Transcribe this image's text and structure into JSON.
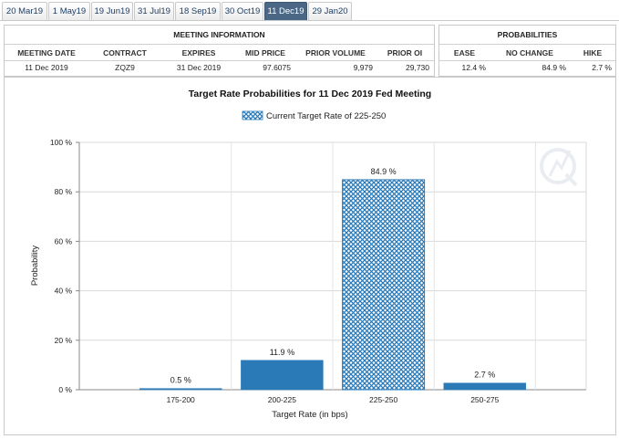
{
  "tabs": [
    {
      "label": "20 Mar19",
      "active": false
    },
    {
      "label": "1 May19",
      "active": false
    },
    {
      "label": "19 Jun19",
      "active": false
    },
    {
      "label": "31 Jul19",
      "active": false
    },
    {
      "label": "18 Sep19",
      "active": false
    },
    {
      "label": "30 Oct19",
      "active": false
    },
    {
      "label": "11 Dec19",
      "active": true
    },
    {
      "label": "29 Jan20",
      "active": false
    }
  ],
  "meeting_info": {
    "title": "MEETING INFORMATION",
    "headers": [
      "MEETING DATE",
      "CONTRACT",
      "EXPIRES",
      "MID PRICE",
      "PRIOR VOLUME",
      "PRIOR OI"
    ],
    "values": [
      "11 Dec 2019",
      "ZQZ9",
      "31 Dec 2019",
      "97.6075",
      "9,979",
      "29,730"
    ]
  },
  "probabilities": {
    "title": "PROBABILITIES",
    "headers": [
      "EASE",
      "NO CHANGE",
      "HIKE"
    ],
    "values": [
      "12.4 %",
      "84.9 %",
      "2.7 %"
    ]
  },
  "colors": {
    "bar": "#2a7ab8",
    "hatch": "#2a7ab8",
    "tab_active": "#4a6786"
  },
  "chart_data": {
    "type": "bar",
    "title": "Target Rate Probabilities for 11 Dec 2019 Fed Meeting",
    "legend": "Current Target Rate of 225-250",
    "legend_position": "top-center",
    "xlabel": "Target Rate (in bps)",
    "ylabel": "Probability",
    "categories": [
      "175-200",
      "200-225",
      "225-250",
      "250-275"
    ],
    "values": [
      0.5,
      11.9,
      84.9,
      2.7
    ],
    "data_labels": [
      "0.5 %",
      "11.9 %",
      "84.9 %",
      "2.7 %"
    ],
    "highlight_index": 2,
    "ylim": [
      0,
      100
    ],
    "yticks": [
      0,
      20,
      40,
      60,
      80,
      100
    ],
    "ytick_labels": [
      "0 %",
      "20 %",
      "40 %",
      "60 %",
      "80 %",
      "100 %"
    ],
    "grid": true
  }
}
